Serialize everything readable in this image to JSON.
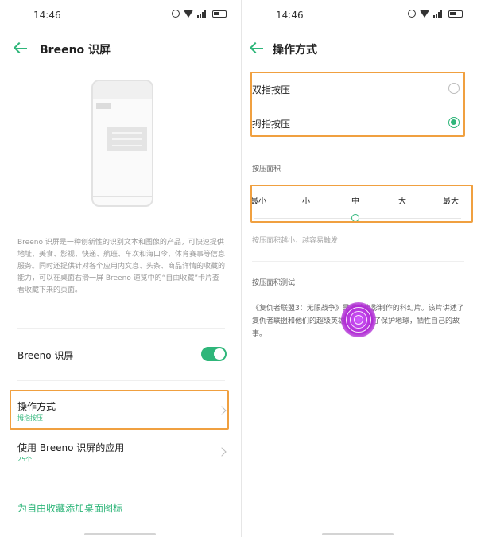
{
  "left": {
    "status": {
      "time": "14:46"
    },
    "title": "Breeno 识屏",
    "description": "Breeno 识屏是一种创新性的识别文本和图像的产品，可快速提供地址、美食、影视、快递、航班、车次和海口令、体育赛事等信息服务。同时还提供针对各个应用内文息、头条、商品详情的收藏的能力，可以在桌面右滑一屏 Breeno 速览中的“自由收藏”卡片查看收藏下来的页面。",
    "toggle_row": {
      "label": "Breeno 识屏",
      "enabled": true
    },
    "mode_row": {
      "label": "操作方式",
      "value": "拇指按压"
    },
    "apps_row": {
      "label": "使用 Breeno 识屏的应用",
      "value": "25个"
    },
    "link": "为自由收藏添加桌面图标"
  },
  "right": {
    "status": {
      "time": "14:46"
    },
    "title": "操作方式",
    "options": [
      {
        "label": "双指按压",
        "selected": false
      },
      {
        "label": "拇指按压",
        "selected": true
      }
    ],
    "press_area": {
      "section_label": "按压面积",
      "scale": [
        "最小",
        "小",
        "中",
        "大",
        "最大"
      ],
      "selected_index": 2,
      "hint": "按压面积越小，越容易触发"
    },
    "test": {
      "section_label": "按压面积测试",
      "sample_text": "《复仇者联盟3：无限战争》是漫威电影制作的科幻片。该片讲述了复仇者联盟和他们的超级英雄盟友们为了保护地球，牺牲自己的故事。"
    }
  },
  "colors": {
    "accent": "#2fb67a",
    "highlight": "#f0a040"
  }
}
